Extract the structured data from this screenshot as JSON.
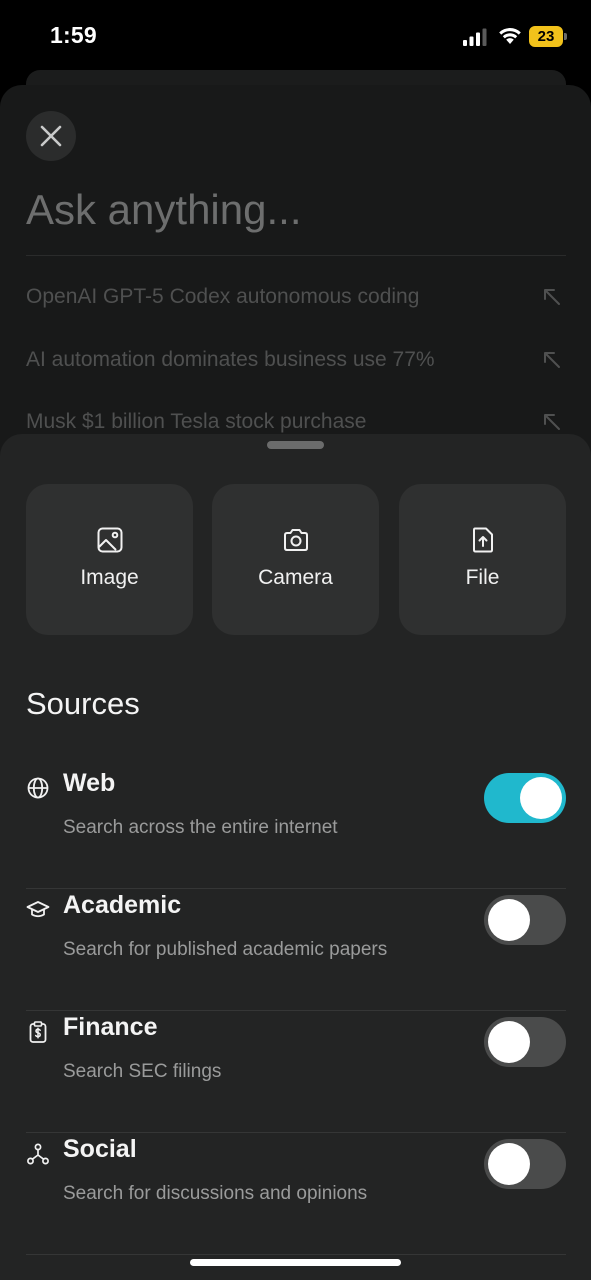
{
  "status_bar": {
    "time": "1:59",
    "battery_level": "23",
    "icons": [
      "signal-icon",
      "wifi-icon",
      "battery-icon"
    ]
  },
  "composer": {
    "placeholder": "Ask anything...",
    "close_icon": "close-icon"
  },
  "suggestions": [
    {
      "text": "OpenAI GPT-5 Codex autonomous coding",
      "icon": "arrow-up-left-icon"
    },
    {
      "text": "AI automation dominates business use 77%",
      "icon": "arrow-up-left-icon"
    },
    {
      "text": "Musk $1 billion Tesla stock purchase",
      "icon": "arrow-up-left-icon"
    }
  ],
  "attach": [
    {
      "label": "Image",
      "icon": "image-icon"
    },
    {
      "label": "Camera",
      "icon": "camera-icon"
    },
    {
      "label": "File",
      "icon": "file-upload-icon"
    }
  ],
  "sources": {
    "title": "Sources",
    "items": [
      {
        "title": "Web",
        "desc": "Search across the entire internet",
        "icon": "globe-icon",
        "enabled": true
      },
      {
        "title": "Academic",
        "desc": "Search for published academic papers",
        "icon": "graduation-cap-icon",
        "enabled": false
      },
      {
        "title": "Finance",
        "desc": "Search SEC filings",
        "icon": "finance-clipboard-icon",
        "enabled": false
      },
      {
        "title": "Social",
        "desc": "Search for discussions and opinions",
        "icon": "social-network-icon",
        "enabled": false
      }
    ]
  },
  "colors": {
    "accent": "#20b8cd",
    "battery": "#f2c21b",
    "sheet_bg": "#232424",
    "card_bg": "#2f3030"
  }
}
